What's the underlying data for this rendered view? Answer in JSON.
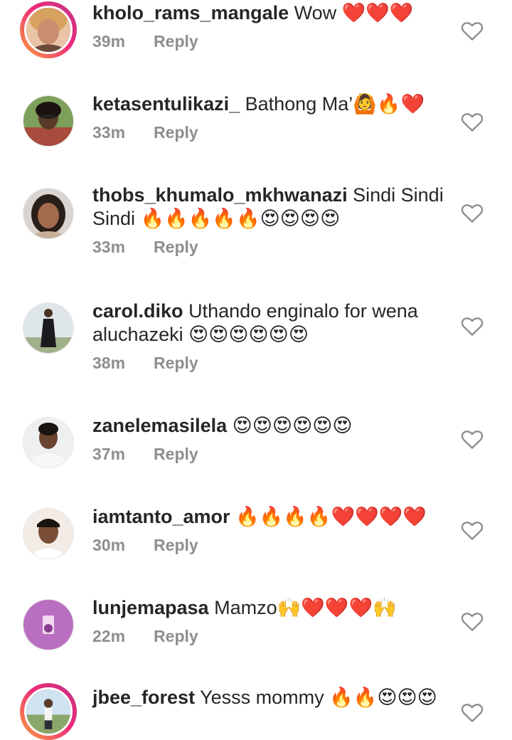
{
  "comments": [
    {
      "username": "kholo_rams_mangale",
      "text": "Wow ❤️❤️❤️",
      "time": "39m",
      "reply": "Reply",
      "avatar": "profile-photo",
      "story_ring": true
    },
    {
      "username": "ketasentulikazi_",
      "text": "Bathong Ma’🙆🔥❤️",
      "time": "33m",
      "reply": "Reply",
      "avatar": "profile-photo",
      "story_ring": false
    },
    {
      "username": "thobs_khumalo_mkhwanazi",
      "text": "Sindi Sindi Sindi 🔥🔥🔥🔥🔥😍😍😍😍",
      "time": "33m",
      "reply": "Reply",
      "avatar": "profile-photo",
      "story_ring": false
    },
    {
      "username": "carol.diko",
      "text": "Uthando enginalo for wena aluchazeki 😍😍😍😍😍😍",
      "time": "38m",
      "reply": "Reply",
      "avatar": "profile-photo",
      "story_ring": false
    },
    {
      "username": "zanelemasilela",
      "text": "😍😍😍😍😍😍",
      "time": "37m",
      "reply": "Reply",
      "avatar": "profile-photo",
      "story_ring": false
    },
    {
      "username": "iamtanto_amor",
      "text": "🔥🔥🔥🔥❤️❤️❤️❤️",
      "time": "30m",
      "reply": "Reply",
      "avatar": "profile-photo",
      "story_ring": false
    },
    {
      "username": "lunjemapasa",
      "text": "Mamzo🙌❤️❤️❤️🙌",
      "time": "22m",
      "reply": "Reply",
      "avatar": "profile-photo",
      "story_ring": false
    },
    {
      "username": "jbee_forest",
      "text": "Yesss mommy 🔥🔥😍😍😍",
      "time": "",
      "reply": "",
      "avatar": "profile-photo",
      "story_ring": true
    }
  ],
  "icons": {
    "like": "heart-outline-icon"
  },
  "colors": {
    "text": "#262626",
    "meta": "#8e8e8e",
    "ring_start": "#f9a33a",
    "ring_end": "#c13584"
  }
}
